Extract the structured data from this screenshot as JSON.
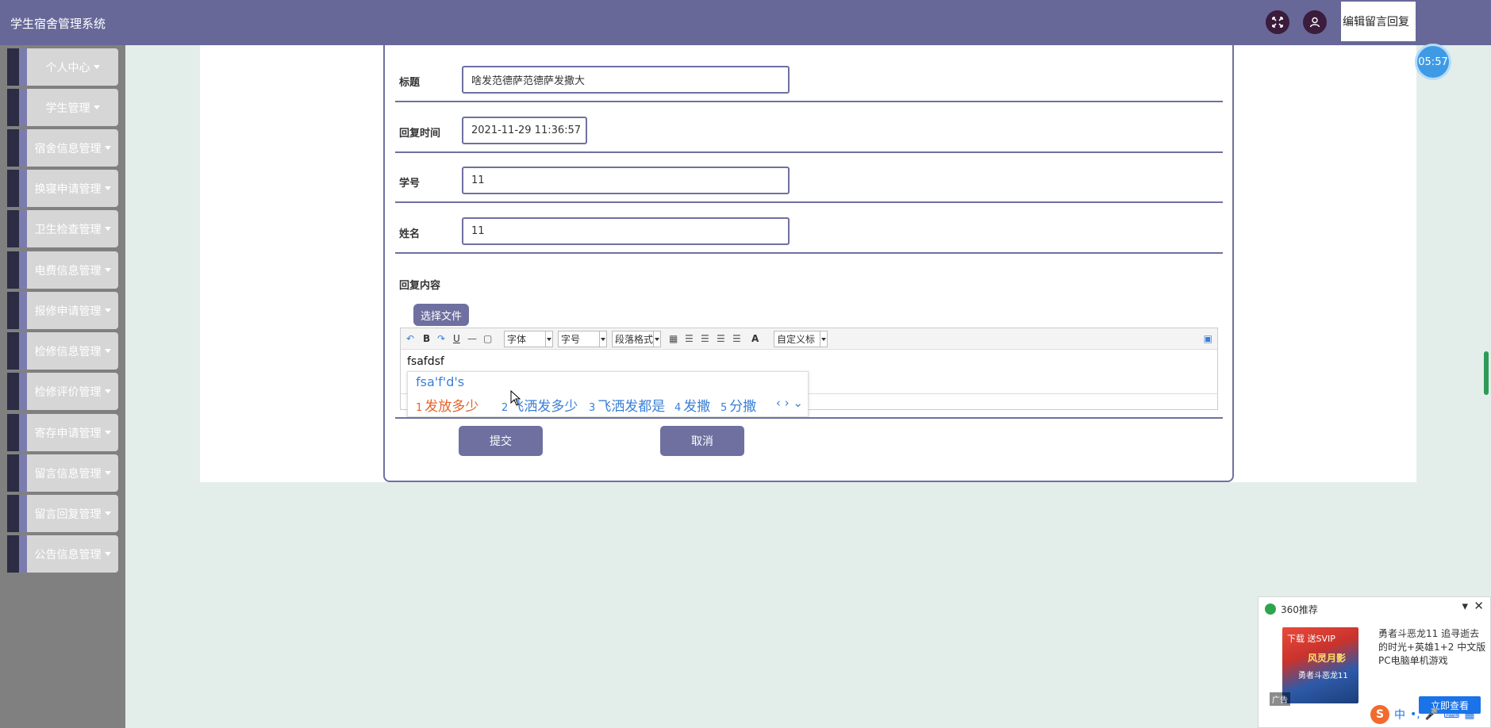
{
  "header": {
    "app_title": "学生宿舍管理系统",
    "tab_label": "编辑留言回复"
  },
  "sidebar": {
    "items": [
      {
        "label": "个人中心"
      },
      {
        "label": "学生管理"
      },
      {
        "label": "宿舍信息管理"
      },
      {
        "label": "换寝申请管理"
      },
      {
        "label": "卫生检查管理"
      },
      {
        "label": "电费信息管理"
      },
      {
        "label": "报修申请管理"
      },
      {
        "label": "检修信息管理"
      },
      {
        "label": "检修评价管理"
      },
      {
        "label": "寄存申请管理"
      },
      {
        "label": "留言信息管理"
      },
      {
        "label": "留言回复管理"
      },
      {
        "label": "公告信息管理"
      }
    ]
  },
  "form": {
    "title_label": "标题",
    "title_value": "啥发范德萨范德萨发撒大",
    "reply_time_label": "回复时间",
    "reply_time_value": "2021-11-29 11:36:57",
    "student_id_label": "学号",
    "student_id_value": "11",
    "name_label": "姓名",
    "name_value": "11",
    "content_label": "回复内容",
    "file_button": "选择文件",
    "editor_text": "fsafdsf",
    "submit_button": "提交",
    "cancel_button": "取消"
  },
  "toolbar": {
    "font_select": "字体",
    "size_select": "字号",
    "paragraph_select": "段落格式",
    "custom_select": "自定义标",
    "bold": "B",
    "underline": "U",
    "font_color": "A"
  },
  "ime": {
    "pinyin": "fsa'f'd's",
    "candidates": [
      {
        "num": "1",
        "text": "发放多少"
      },
      {
        "num": "2",
        "text": "飞洒发多少"
      },
      {
        "num": "3",
        "text": "飞洒发都是"
      },
      {
        "num": "4",
        "text": "发撒"
      },
      {
        "num": "5",
        "text": "分撒"
      }
    ],
    "nav": "‹ › ⌄"
  },
  "timer": "05:57",
  "ad": {
    "header": "360推荐",
    "img_badge": "下载 送SVIP",
    "img_title": "风灵月影",
    "img_sub": "勇者斗恶龙11",
    "ad_tag": "广告",
    "text": "勇者斗恶龙11 追寻逝去的时光+英雄1+2 中文版 PC电脑单机游戏",
    "cta": "立即查看"
  },
  "tray": {
    "sogou": "S",
    "lang": "中"
  }
}
